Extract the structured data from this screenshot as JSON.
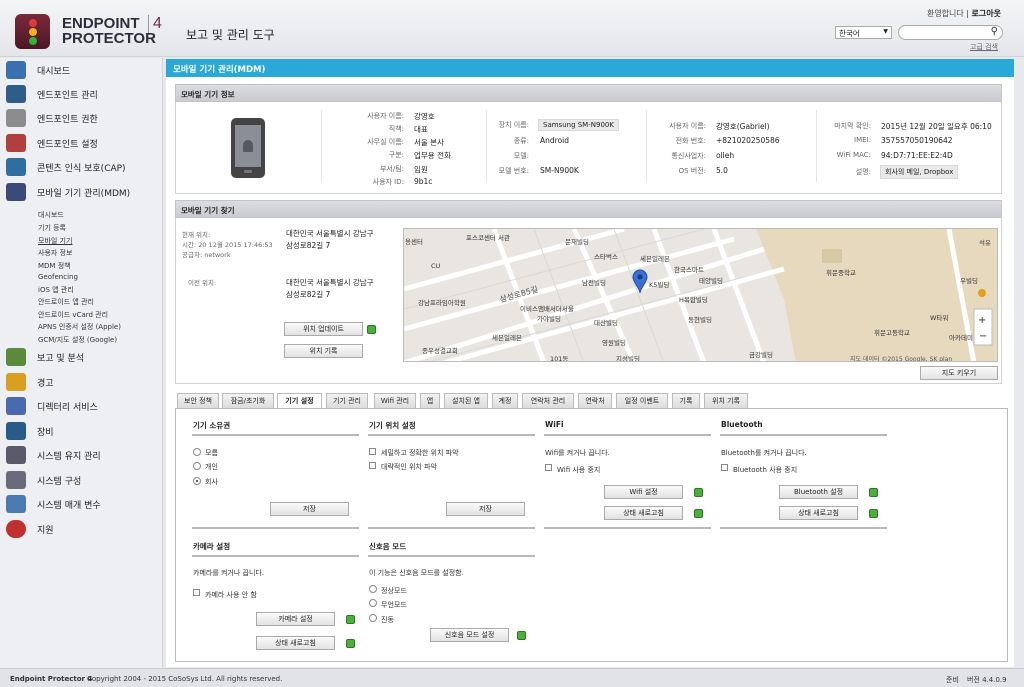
{
  "header": {
    "logo_line1": "ENDPOINT",
    "logo_line2": "PROTECTOR",
    "logo_num": "4",
    "app_title": "보고 및 관리 도구",
    "welcome": "환영합니다 | ",
    "logout": "로그아웃",
    "language": "한국어",
    "advanced_search": "고급 검색"
  },
  "sidebar": {
    "items": [
      {
        "label": "대시보드",
        "icon": "dashboard-icon",
        "color": "#3a6fb0"
      },
      {
        "label": "엔드포인트 관리",
        "icon": "computer-icon",
        "color": "#2f5d8a"
      },
      {
        "label": "엔드포인트 권한",
        "icon": "key-icon",
        "color": "#8c8c8c"
      },
      {
        "label": "엔드포인트 설정",
        "icon": "tools-icon",
        "color": "#b04040"
      },
      {
        "label": "콘텐츠 인식 보호(CAP)",
        "icon": "cap-icon",
        "color": "#2f6fa0"
      },
      {
        "label": "모바일 기기 관리(MDM)",
        "icon": "tablet-icon",
        "color": "#3a4a7a"
      }
    ],
    "sub_items": [
      "대시보드",
      "기기 등록",
      "모바일 기기",
      "사용자 정보",
      "MDM 정책",
      "Geofencing",
      "iOS 앱 관리",
      "안드로이드 앱 관리",
      "안드로이드 vCard 관리",
      "APNS 인증서 설정 (Apple)",
      "GCM/지도 설정 (Google)"
    ],
    "lower_items": [
      {
        "label": "보고 및 분석",
        "icon": "chart-icon",
        "color": "#5a8a3a"
      },
      {
        "label": "경고",
        "icon": "warning-icon",
        "color": "#d8a020"
      },
      {
        "label": "디렉터리 서비스",
        "icon": "directory-icon",
        "color": "#4a6ab0"
      },
      {
        "label": "장비",
        "icon": "appliance-icon",
        "color": "#2a5a8a"
      },
      {
        "label": "시스템 유지 관리",
        "icon": "maintenance-icon",
        "color": "#5a5a6a"
      },
      {
        "label": "시스템 구성",
        "icon": "config-icon",
        "color": "#6a6a7a"
      },
      {
        "label": "시스템 매개 변수",
        "icon": "parameters-icon",
        "color": "#4a7ab0"
      },
      {
        "label": "지원",
        "icon": "support-icon",
        "color": "#c03030"
      }
    ]
  },
  "page_title": "모바일 기기 관리(MDM)",
  "device_info": {
    "title": "모바일 기기 정보",
    "col1": [
      {
        "label": "사용자 이름:",
        "value": "강영호"
      },
      {
        "label": "직책:",
        "value": "대표"
      },
      {
        "label": "사무실 이름:",
        "value": "서울 본사"
      },
      {
        "label": "구분:",
        "value": "업무용 전화"
      },
      {
        "label": "부서/팀:",
        "value": "임원"
      },
      {
        "label": "사용자 ID:",
        "value": "9b1c"
      }
    ],
    "col2": [
      {
        "label": "장치 이름:",
        "value": "Samsung SM-N900K"
      },
      {
        "label": "종류:",
        "value": "Android"
      },
      {
        "label": "모델:",
        "value": ""
      },
      {
        "label": "모델 번호:",
        "value": "SM-N900K"
      }
    ],
    "col3": [
      {
        "label": "사용자 이름:",
        "value": "강영호(Gabriel)"
      },
      {
        "label": "전화 번호:",
        "value": "+821020250586"
      },
      {
        "label": "통신사업자:",
        "value": "olleh"
      },
      {
        "label": "OS 버전:",
        "value": "5.0"
      }
    ],
    "col4": [
      {
        "label": "마지막 확인:",
        "value": "2015년 12월 20일 일요후 06:10"
      },
      {
        "label": "IMEI:",
        "value": "357557050190642"
      },
      {
        "label": "WiFi MAC:",
        "value": "94:D7:71:EE:E2:4D"
      },
      {
        "label": "설명:",
        "value": "회사의 메일, Dropbox"
      }
    ]
  },
  "locate": {
    "title": "모바일 기기 찾기",
    "current_label": "현재 위치:",
    "time_label": "시간: 20 12월 2015 17:46:53",
    "provider_label": "공급자: network",
    "current_addr1": "대한민국 서울특별시 강남구",
    "current_addr2": "삼성로82길 7",
    "previous_label": "이전 위치:",
    "previous_addr1": "대한민국 서울특별시 강남구",
    "previous_addr2": "삼성로82길 7",
    "update_btn": "위치 업데이트",
    "history_btn": "위치 기록",
    "enlarge_btn": "지도 키우기",
    "map_labels": [
      "포스코센터 서관",
      "문재빌딩",
      "스타벅스",
      "세븐일레븐",
      "한국스마트",
      "태양빌딩",
      "남전빌딩",
      "K5빌딩",
      "H복합빌딩",
      "동현빌딩",
      "대산빌딩",
      "영원빌딩",
      "지성빌딩",
      "금강빌딩",
      "이비스앰배서더서울",
      "가야빌딩",
      "세븐일레븐",
      "강남프라임어학원",
      "종우성결교회",
      "101동",
      "삼성로85길",
      "휘문중학교",
      "휘문고등학교",
      "W타워",
      "아카데미",
      "석유",
      "우빌딩",
      "CU",
      "용센터"
    ],
    "map_credit": "지도 데이터 ©2015 Google, SK plan"
  },
  "tabs": [
    "보안 정책",
    "잠금/초기화",
    "기기 설정",
    "기기 관리",
    "Wifi 관리",
    "앱",
    "설치된 앱",
    "계정",
    "연락처 관리",
    "연락처",
    "일정 이벤트",
    "기록",
    "위치 기록"
  ],
  "settings": {
    "ownership": {
      "title": "기기 소유권",
      "options": [
        "모름",
        "개인",
        "회사"
      ],
      "save": "저장"
    },
    "location": {
      "title": "기기 위치 설정",
      "options": [
        "세밀하고 정확한 위치 파악",
        "대략적인 위치 파악"
      ],
      "save": "저장"
    },
    "wifi": {
      "title": "WiFi",
      "desc": "Wifi를 켜거나 끕니다.",
      "option": "Wifi 사용 중지",
      "settings_btn": "Wifi 설정",
      "refresh_btn": "상태 새로고침"
    },
    "bluetooth": {
      "title": "Bluetooth",
      "desc": "Bluetooth를 켜거나 끕니다.",
      "option": "Bluetooth 사용 중지",
      "settings_btn": "Bluetooth 설정",
      "refresh_btn": "상태 새로고침"
    },
    "camera": {
      "title": "카메라 설정",
      "desc": "카메라를 켜거나 끕니다.",
      "option": "카메라 사용 안 함",
      "settings_btn": "카메라 설정",
      "refresh_btn": "상태 새로고침"
    },
    "ringer": {
      "title": "신호음 모드",
      "desc": "이 기능은 신호음 모드를 설정함.",
      "options": [
        "정상모드",
        "무언모드",
        "진동"
      ],
      "settings_btn": "신호음 모드 설정"
    }
  },
  "footer": {
    "brand": "Endpoint Protector 4",
    "copyright": "Copyright 2004 - 2015 CoSoSys Ltd. All rights reserved.",
    "status": "준비",
    "version": "버전 4.4.0.9"
  }
}
